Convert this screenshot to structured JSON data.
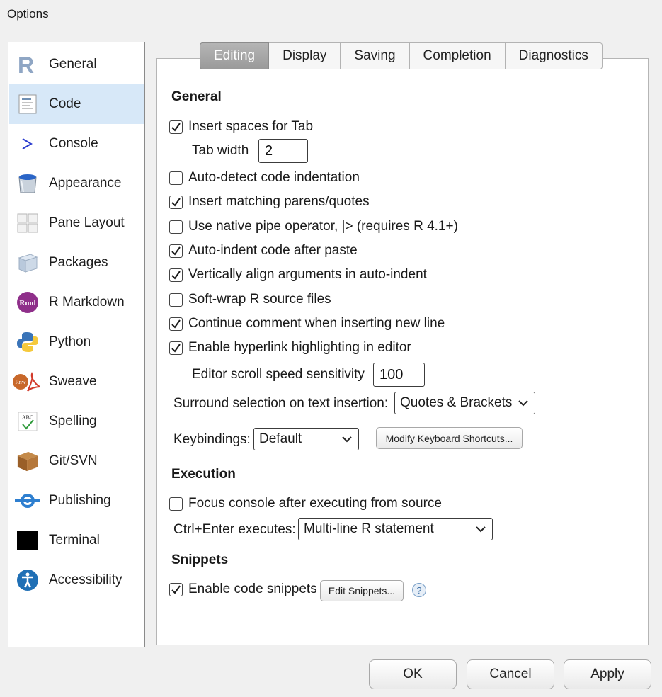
{
  "window": {
    "title": "Options"
  },
  "sidebar": {
    "items": [
      {
        "label": "General",
        "icon": "r-logo-icon"
      },
      {
        "label": "Code",
        "icon": "code-document-icon",
        "selected": true
      },
      {
        "label": "Console",
        "icon": "console-prompt-icon"
      },
      {
        "label": "Appearance",
        "icon": "paint-bucket-icon"
      },
      {
        "label": "Pane Layout",
        "icon": "pane-layout-icon"
      },
      {
        "label": "Packages",
        "icon": "package-cube-icon"
      },
      {
        "label": "R Markdown",
        "icon": "rmd-icon"
      },
      {
        "label": "Python",
        "icon": "python-icon"
      },
      {
        "label": "Sweave",
        "icon": "sweave-icon"
      },
      {
        "label": "Spelling",
        "icon": "spelling-icon"
      },
      {
        "label": "Git/SVN",
        "icon": "git-box-icon"
      },
      {
        "label": "Publishing",
        "icon": "publishing-icon"
      },
      {
        "label": "Terminal",
        "icon": "terminal-icon"
      },
      {
        "label": "Accessibility",
        "icon": "accessibility-icon"
      }
    ]
  },
  "tabs": [
    {
      "label": "Editing",
      "active": true
    },
    {
      "label": "Display"
    },
    {
      "label": "Saving"
    },
    {
      "label": "Completion"
    },
    {
      "label": "Diagnostics"
    }
  ],
  "general": {
    "heading": "General",
    "insert_spaces": {
      "label": "Insert spaces for Tab",
      "checked": true
    },
    "tab_width": {
      "label": "Tab width",
      "value": "2"
    },
    "auto_detect": {
      "label": "Auto-detect code indentation",
      "checked": false
    },
    "matching_parens": {
      "label": "Insert matching parens/quotes",
      "checked": true
    },
    "native_pipe": {
      "label": "Use native pipe operator, |> (requires R 4.1+)",
      "checked": false
    },
    "auto_indent": {
      "label": "Auto-indent code after paste",
      "checked": true
    },
    "vertical_align": {
      "label": "Vertically align arguments in auto-indent",
      "checked": true
    },
    "soft_wrap": {
      "label": "Soft-wrap R source files",
      "checked": false
    },
    "continue_comment": {
      "label": "Continue comment when inserting new line",
      "checked": true
    },
    "hyperlink": {
      "label": "Enable hyperlink highlighting in editor",
      "checked": true
    },
    "scroll_speed": {
      "label": "Editor scroll speed sensitivity",
      "value": "100"
    },
    "surround": {
      "label": "Surround selection on text insertion:",
      "value": "Quotes & Brackets"
    },
    "keybindings": {
      "label": "Keybindings:",
      "value": "Default"
    },
    "modify_shortcuts": "Modify Keyboard Shortcuts..."
  },
  "execution": {
    "heading": "Execution",
    "focus_console": {
      "label": "Focus console after executing from source",
      "checked": false
    },
    "ctrl_enter": {
      "label": "Ctrl+Enter executes:",
      "value": "Multi-line R statement"
    }
  },
  "snippets": {
    "heading": "Snippets",
    "enable": {
      "label": "Enable code snippets",
      "checked": true
    },
    "edit_button": "Edit Snippets...",
    "help": "?"
  },
  "footer": {
    "ok": "OK",
    "cancel": "Cancel",
    "apply": "Apply"
  },
  "colors": {
    "selection": "#d7e8f8",
    "tab_active": "#a6a6a6",
    "help_blue": "#3b6ea5"
  }
}
